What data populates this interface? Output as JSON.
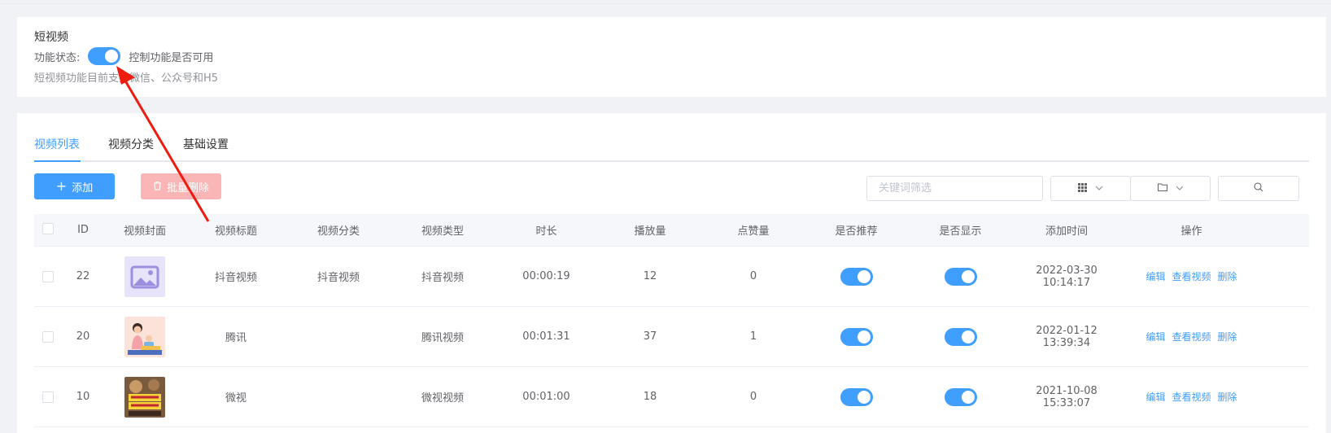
{
  "feature_card": {
    "title": "短视频",
    "status_label": "功能状态:",
    "status_hint": "控制功能是否可用",
    "description": "短视频功能目前支持微信、公众号和H5",
    "enabled": true
  },
  "tabs": [
    {
      "label": "视频列表",
      "active": true
    },
    {
      "label": "视频分类",
      "active": false
    },
    {
      "label": "基础设置",
      "active": false
    }
  ],
  "toolbar": {
    "add_label": "添加",
    "batch_delete_label": "批量删除",
    "search_placeholder": "关键词筛选"
  },
  "table": {
    "headers": [
      "ID",
      "视频封面",
      "视频标题",
      "视频分类",
      "视频类型",
      "时长",
      "播放量",
      "点赞量",
      "是否推荐",
      "是否显示",
      "添加时间",
      "操作"
    ],
    "rows": [
      {
        "id": "22",
        "cover": "placeholder-image",
        "title": "抖音视频",
        "category": "抖音视频",
        "type": "抖音视频",
        "duration": "00:00:19",
        "plays": "12",
        "likes": "0",
        "recommended": true,
        "shown": true,
        "added": "2022-03-30 10:14:17"
      },
      {
        "id": "20",
        "cover": "cartoon-family-image",
        "title": "腾讯",
        "category": "",
        "type": "腾讯视频",
        "duration": "00:01:31",
        "plays": "37",
        "likes": "1",
        "recommended": true,
        "shown": true,
        "added": "2022-01-12 13:39:34"
      },
      {
        "id": "10",
        "cover": "food-poster-image",
        "title": "微视",
        "category": "",
        "type": "微视视频",
        "duration": "00:01:00",
        "plays": "18",
        "likes": "0",
        "recommended": true,
        "shown": true,
        "added": "2021-10-08 15:33:07"
      }
    ],
    "ops": [
      "编辑",
      "查看视频",
      "删除"
    ]
  },
  "colors": {
    "accent": "#409eff",
    "danger_disabled": "#fab6b6",
    "annotation_arrow": "#ee1c0e"
  }
}
